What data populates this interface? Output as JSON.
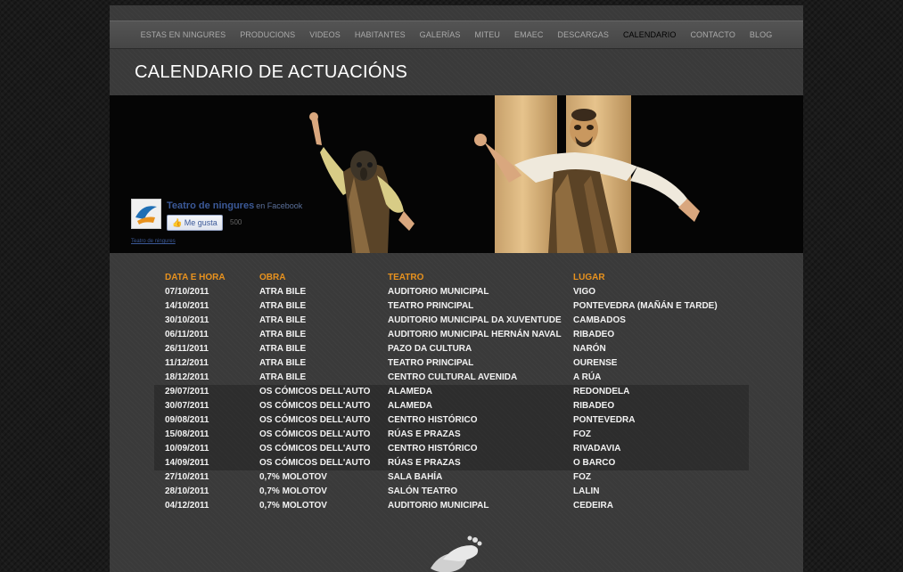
{
  "nav": {
    "items": [
      "ESTAS EN NINGURES",
      "PRODUCIONS",
      "VIDEOS",
      "HABITANTES",
      "GALERÍAS",
      "MITEU",
      "EMAEC",
      "DESCARGAS",
      "CALENDARIO",
      "CONTACTO",
      "BLOG"
    ],
    "active": "CALENDARIO"
  },
  "page_title": "CALENDARIO DE ACTUACIÓNS",
  "facebook": {
    "page_name": "Teatro de ningures",
    "on_label": "en Facebook",
    "like_label": "Me gusta",
    "like_count": "500",
    "footer_link": "Teatro de ningures"
  },
  "table": {
    "headers": [
      "DATA E HORA",
      "OBRA",
      "TEATRO",
      "LUGAR"
    ],
    "rows": [
      [
        "07/10/2011",
        "ATRA BILE",
        "AUDITORIO MUNICIPAL",
        "VIGO"
      ],
      [
        "14/10/2011",
        "ATRA BILE",
        "TEATRO PRINCIPAL",
        "PONTEVEDRA (MAÑÁN E TARDE)"
      ],
      [
        "30/10/2011",
        "ATRA BILE",
        "AUDITORIO MUNICIPAL DA XUVENTUDE",
        "CAMBADOS"
      ],
      [
        "06/11/2011",
        "ATRA BILE",
        "AUDITORIO MUNICIPAL HERNÁN NAVAL",
        "RIBADEO"
      ],
      [
        "26/11/2011",
        "ATRA BILE",
        "PAZO DA CULTURA",
        "NARÓN"
      ],
      [
        "11/12/2011",
        "ATRA BILE",
        "TEATRO PRINCIPAL",
        "OURENSE"
      ],
      [
        "18/12/2011",
        "ATRA BILE",
        "CENTRO CULTURAL AVENIDA",
        "A RÚA"
      ],
      [
        "29/07/2011",
        "OS CÓMICOS DELL'AUTO",
        "ALAMEDA",
        "REDONDELA"
      ],
      [
        "30/07/2011",
        "OS CÓMICOS DELL'AUTO",
        "ALAMEDA",
        "RIBADEO"
      ],
      [
        "09/08/2011",
        "OS CÓMICOS DELL'AUTO",
        "CENTRO HISTÓRICO",
        "PONTEVEDRA"
      ],
      [
        "15/08/2011",
        "OS CÓMICOS DELL'AUTO",
        "RÚAS E PRAZAS",
        "FOZ"
      ],
      [
        "10/09/2011",
        "OS CÓMICOS DELL'AUTO",
        "CENTRO HISTÓRICO",
        "RIVADAVIA"
      ],
      [
        "14/09/2011",
        "OS CÓMICOS DELL'AUTO",
        "RÚAS E PRAZAS",
        "O BARCO"
      ],
      [
        "27/10/2011",
        "0,7% MOLOTOV",
        "SALA BAHÍA",
        "FOZ"
      ],
      [
        "28/10/2011",
        "0,7% MOLOTOV",
        "SALÓN TEATRO",
        "LALIN"
      ],
      [
        "04/12/2011",
        "0,7% MOLOTOV",
        "AUDITORIO MUNICIPAL",
        "CEDEIRA"
      ]
    ],
    "shaded_rows": [
      7,
      8,
      9,
      10,
      11,
      12
    ]
  },
  "icons": {
    "footer": "footprint-logo-icon",
    "like": "thumbs-up-icon",
    "fb_logo": "ningures-logo-icon"
  },
  "colors": {
    "header_text": "#e8921e",
    "active_nav": "#000000",
    "facebook_blue": "#3b5998"
  }
}
